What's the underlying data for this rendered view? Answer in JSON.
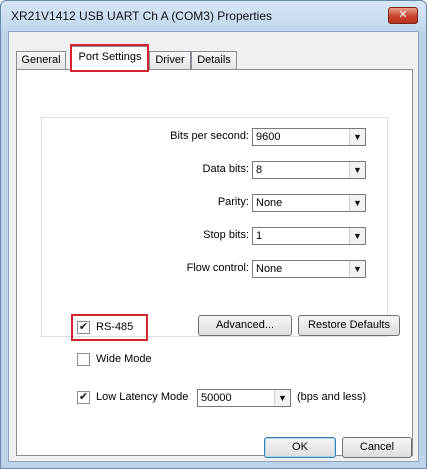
{
  "window": {
    "title": "XR21V1412 USB UART Ch A (COM3) Properties",
    "close_glyph": "✕"
  },
  "tabs": [
    {
      "label": "General",
      "active": false
    },
    {
      "label": "Port Settings",
      "active": true
    },
    {
      "label": "Driver",
      "active": false
    },
    {
      "label": "Details",
      "active": false
    }
  ],
  "fields": [
    {
      "label": "Bits per second:",
      "value": "9600"
    },
    {
      "label": "Data bits:",
      "value": "8"
    },
    {
      "label": "Parity:",
      "value": "None"
    },
    {
      "label": "Stop bits:",
      "value": "1"
    },
    {
      "label": "Flow control:",
      "value": "None"
    }
  ],
  "options": {
    "rs485": {
      "label": "RS-485",
      "checked": true
    },
    "wide_mode": {
      "label": "Wide Mode",
      "checked": false
    },
    "low_latency": {
      "label": "Low Latency Mode",
      "checked": true,
      "value": "50000",
      "suffix": "(bps and less)"
    }
  },
  "buttons": {
    "advanced": "Advanced...",
    "restore_defaults": "Restore Defaults",
    "ok": "OK",
    "cancel": "Cancel"
  },
  "glyphs": {
    "check": "✔",
    "dropdown": "▼"
  },
  "colors": {
    "highlight": "#d3242f",
    "close": "#c6432a"
  }
}
